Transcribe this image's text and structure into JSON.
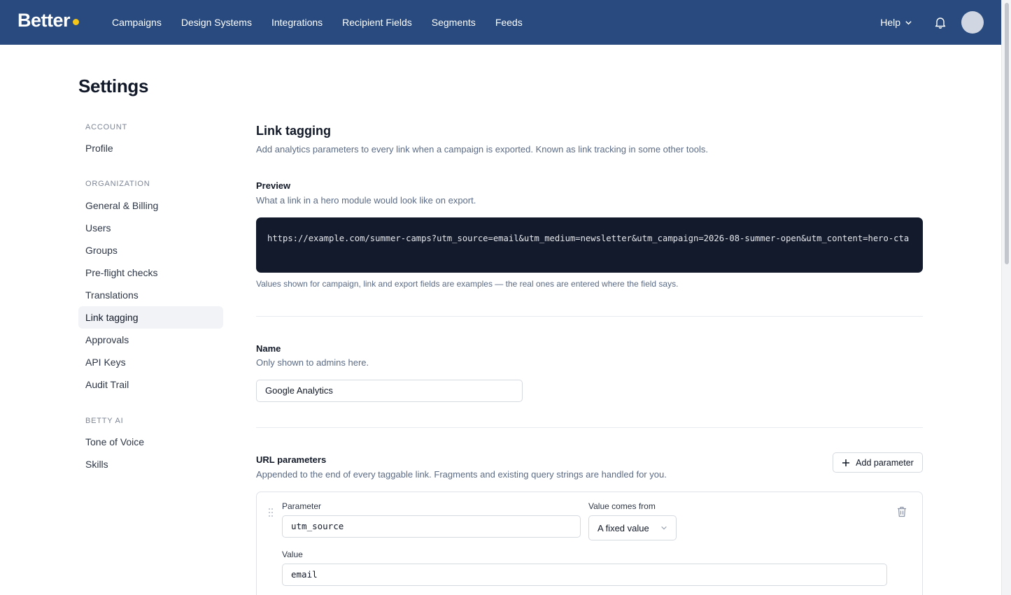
{
  "brand": {
    "name": "Better",
    "dot_color": "#f5c518",
    "nav_bg": "#284a7e"
  },
  "nav": {
    "items": [
      "Campaigns",
      "Design Systems",
      "Integrations",
      "Recipient Fields",
      "Segments",
      "Feeds"
    ],
    "help_label": "Help",
    "help_icon": "chevron-down-icon",
    "bell_icon": "bell-icon",
    "avatar_icon": "avatar"
  },
  "page": {
    "title": "Settings"
  },
  "sidebar": {
    "sections": [
      {
        "heading": "ACCOUNT",
        "items": [
          "Profile"
        ]
      },
      {
        "heading": "ORGANIZATION",
        "items": [
          "General & Billing",
          "Users",
          "Groups",
          "Pre-flight checks",
          "Translations",
          "Link tagging",
          "Approvals",
          "API Keys",
          "Audit Trail"
        ]
      },
      {
        "heading": "BETTY AI",
        "items": [
          "Tone of Voice",
          "Skills"
        ]
      }
    ],
    "active": "Link tagging"
  },
  "main": {
    "title": "Link tagging",
    "description": "Add analytics parameters to every link when a campaign is exported. Known as link tracking in some other tools.",
    "preview": {
      "label": "Preview",
      "description": "What a link in a hero module would look like on export.",
      "url": "https://example.com/summer-camps?utm_source=email&utm_medium=newsletter&utm_campaign=2026-08-summer-open&utm_content=hero-cta",
      "note": "Values shown for campaign, link and export fields are examples — the real ones are entered where the field says."
    },
    "name": {
      "label": "Name",
      "description": "Only shown to admins here.",
      "value": "Google Analytics"
    },
    "url_params": {
      "label": "URL parameters",
      "description": "Appended to the end of every taggable link. Fragments and existing query strings are handled for you.",
      "add_button": "Add parameter",
      "add_icon": "plus-icon",
      "params": [
        {
          "parameter_label": "Parameter",
          "parameter": "utm_source",
          "source_label": "Value comes from",
          "source": "A fixed value",
          "value_label": "Value",
          "value": "email"
        }
      ]
    }
  }
}
